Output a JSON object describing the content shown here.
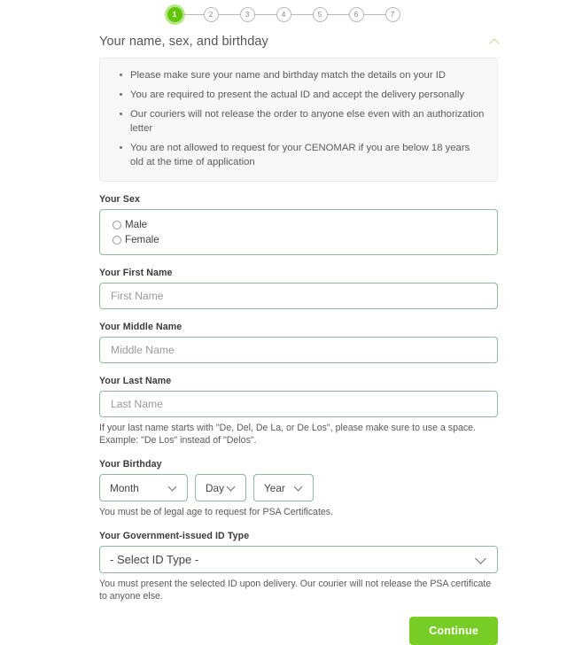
{
  "stepper": {
    "steps": [
      {
        "label": "1",
        "state": "active"
      },
      {
        "label": "2",
        "state": "inactive"
      },
      {
        "label": "3",
        "state": "inactive"
      },
      {
        "label": "4",
        "state": "inactive"
      },
      {
        "label": "5",
        "state": "inactive"
      },
      {
        "label": "6",
        "state": "inactive"
      },
      {
        "label": "7",
        "state": "inactive"
      }
    ],
    "active_index": 1,
    "total": 7
  },
  "section": {
    "title": "Your name, sex, and birthday",
    "collapse_icon": "chevron-up-icon"
  },
  "notice": {
    "items": [
      "Please make sure your name and birthday match the details on your ID",
      "You are required to present the actual ID and accept the delivery personally",
      "Our couriers will not release the order to anyone else even with an authorization letter",
      "You are not allowed to request for your CENOMAR if you are below 18 years old at the time of application"
    ]
  },
  "form": {
    "sex": {
      "label": "Your Sex",
      "options": [
        {
          "label": "Male",
          "selected": false
        },
        {
          "label": "Female",
          "selected": false
        }
      ]
    },
    "first_name": {
      "label": "Your First Name",
      "placeholder": "First Name",
      "value": ""
    },
    "middle_name": {
      "label": "Your Middle Name",
      "placeholder": "Middle Name",
      "value": ""
    },
    "last_name": {
      "label": "Your Last Name",
      "placeholder": "Last Name",
      "value": "",
      "helper": "If your last name starts with \"De, Del, De La, or De Los\", please make sure to use a space. Example: \"De Los\" instead of \"Delos\"."
    },
    "birthday": {
      "label": "Your Birthday",
      "month": "Month",
      "day": "Day",
      "year": "Year",
      "helper": "You must be of legal age to request for PSA Certificates."
    },
    "id_type": {
      "label": "Your Government-issued ID Type",
      "selected": "- Select ID Type -",
      "helper": "You must present the selected ID upon delivery. Our courier will not release the PSA certificate to anyone else."
    }
  },
  "actions": {
    "continue_label": "Continue"
  },
  "colors": {
    "accent_green": "#78cc26",
    "step_active": "#63c60b",
    "step_ring": "#b6e986",
    "field_border": "#8fb89f",
    "notice_bg": "#f8f8f8",
    "text": "#3c3c3c",
    "helper_text": "#5a5a5a"
  }
}
